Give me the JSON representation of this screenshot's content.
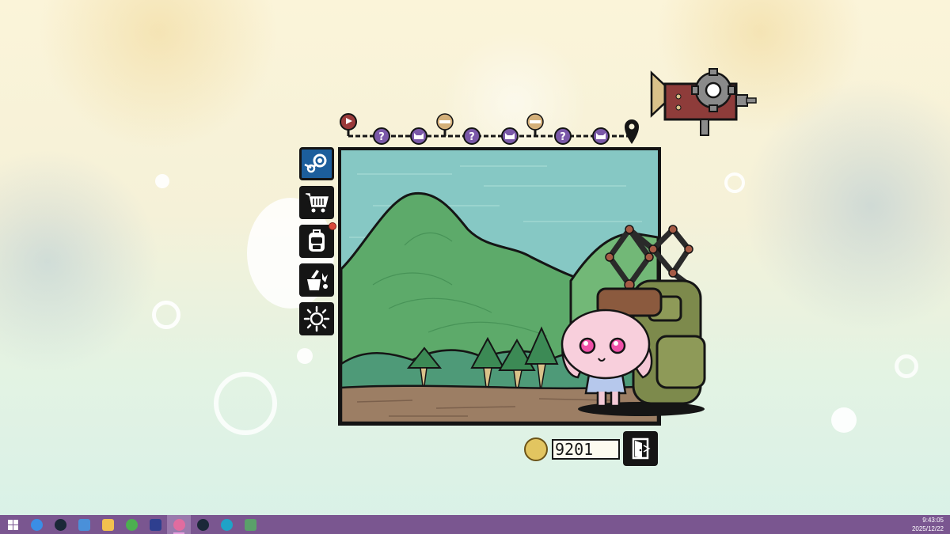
{
  "hud": {
    "coins": "9201"
  },
  "route": {
    "nodes": [
      {
        "type": "start-flag",
        "icon": "flag-icon",
        "color": "#9b3a3a"
      },
      {
        "type": "unknown",
        "icon": "question-icon",
        "color": "#7a58a8"
      },
      {
        "type": "encounter",
        "icon": "cat-face-icon",
        "color": "#7a58a8"
      },
      {
        "type": "rest",
        "icon": "tent-icon",
        "color": "#d4b07a"
      },
      {
        "type": "unknown",
        "icon": "question-icon",
        "color": "#7a58a8"
      },
      {
        "type": "encounter",
        "icon": "cat-face-icon",
        "color": "#7a58a8"
      },
      {
        "type": "rest",
        "icon": "tent-icon",
        "color": "#d4b07a"
      },
      {
        "type": "unknown",
        "icon": "question-icon",
        "color": "#7a58a8"
      },
      {
        "type": "encounter",
        "icon": "cat-face-icon",
        "color": "#7a58a8"
      },
      {
        "type": "destination",
        "icon": "map-pin-icon",
        "color": "#151515"
      }
    ]
  },
  "side_menu": [
    {
      "name": "steam-button",
      "icon": "steam-icon"
    },
    {
      "name": "shop-button",
      "icon": "shopping-cart-icon"
    },
    {
      "name": "backpack-button",
      "icon": "backpack-icon",
      "badge": true
    },
    {
      "name": "items-button",
      "icon": "crafting-icon"
    },
    {
      "name": "settings-button",
      "icon": "sun-gear-icon"
    }
  ],
  "taskbar": {
    "apps": [
      {
        "name": "start-button",
        "icon": "windows-icon",
        "color": "#ffffff"
      },
      {
        "name": "taskbar-app-edge-dev",
        "icon": "edge-icon",
        "color": "#3a8ee6"
      },
      {
        "name": "taskbar-app-steam",
        "icon": "steam-icon",
        "color": "#1b2838"
      },
      {
        "name": "taskbar-app-remote",
        "icon": "remote-desktop-icon",
        "color": "#4a90d9"
      },
      {
        "name": "taskbar-app-explorer",
        "icon": "folder-icon",
        "color": "#f2c14e"
      },
      {
        "name": "taskbar-app-chrome",
        "icon": "chrome-icon",
        "color": "#4caf50"
      },
      {
        "name": "taskbar-app-store",
        "icon": "store-icon",
        "color": "#2e3f8f"
      },
      {
        "name": "taskbar-app-game",
        "icon": "game-icon",
        "color": "#e06c9f",
        "active": true
      },
      {
        "name": "taskbar-app-steam-2",
        "icon": "steam-icon",
        "color": "#1b2838"
      },
      {
        "name": "taskbar-app-edge",
        "icon": "edge-icon",
        "color": "#1fa3c7"
      },
      {
        "name": "taskbar-app-monitor",
        "icon": "window-icon",
        "color": "#5aa06a"
      }
    ],
    "time": "9:43:05",
    "date": "2025/12/22"
  }
}
